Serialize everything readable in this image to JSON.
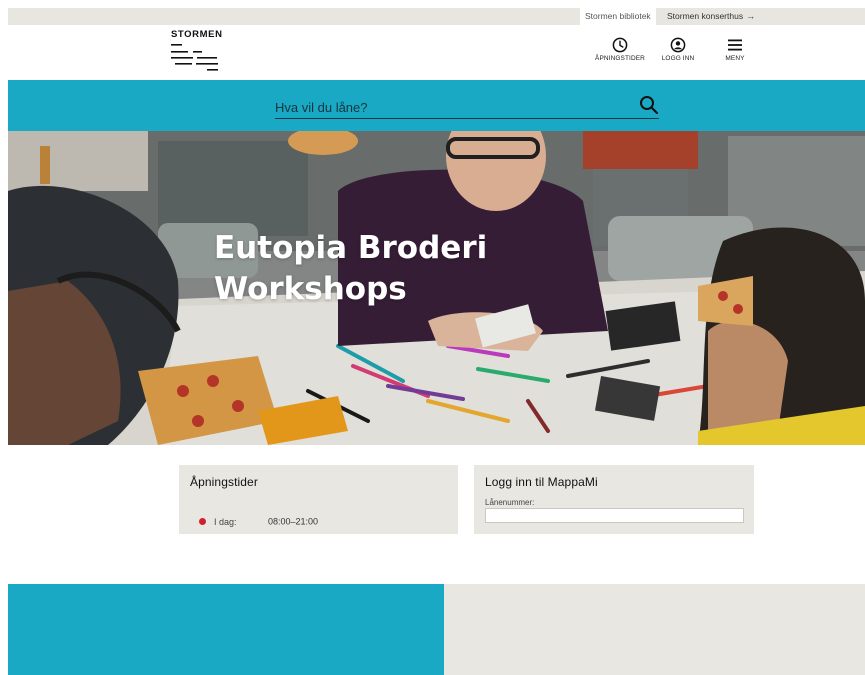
{
  "site_tabs": [
    {
      "label": "Stormen bibliotek"
    },
    {
      "label": "Stormen konserthus",
      "arrow": "→"
    }
  ],
  "logo": {
    "text": "STORMEN"
  },
  "header_nav": {
    "hours": {
      "label": "ÅPNINGSTIDER",
      "icon": "clock-icon"
    },
    "login": {
      "label": "LOGG INN",
      "icon": "user-icon"
    },
    "menu": {
      "label": "MENY",
      "icon": "hamburger-icon"
    }
  },
  "search": {
    "placeholder": "Hva vil du låne?",
    "value": "",
    "icon": "search-icon"
  },
  "hero": {
    "title": "Eutopia Broderi Workshops"
  },
  "hours_card": {
    "title": "Åpningstider",
    "today_label": "I dag:",
    "today_time": "08:00–21:00"
  },
  "login_card": {
    "title": "Logg inn til MappaMi",
    "field_label": "Lånenummer:",
    "field_value": ""
  },
  "colors": {
    "accent_teal": "#1aa9c4",
    "panel_grey": "#e8e7e2",
    "status_red": "#d0202c"
  }
}
